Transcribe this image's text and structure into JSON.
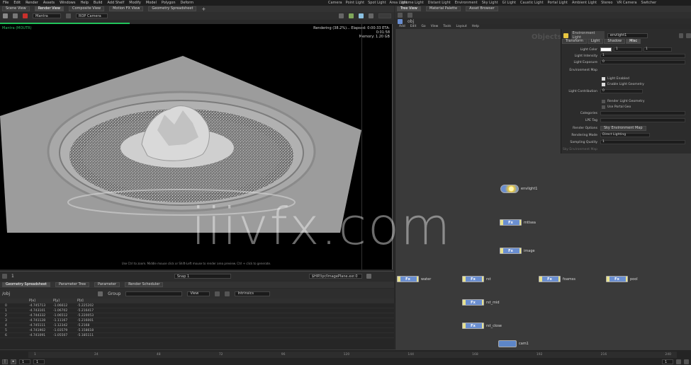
{
  "menu": {
    "left_items": [
      "File",
      "Edit",
      "Render",
      "Assets",
      "Windows",
      "Help",
      "Build",
      "Add Shelf",
      "Modify",
      "Model",
      "Polygon",
      "Deform"
    ],
    "center_items": [
      "Camera",
      "Point Light",
      "Spot Light",
      "Area Light"
    ],
    "right_items": [
      "Volume Light",
      "Distant Light",
      "Environment",
      "Sky Light",
      "GI Light",
      "Caustic Light",
      "Portal Light",
      "Ambient Light",
      "Stereo",
      "VR Camera",
      "Switcher"
    ]
  },
  "left_tabs": [
    "Scene View",
    "Render View",
    "Composite View",
    "Motion FX View",
    "Geometry Spreadsheet"
  ],
  "viewer": {
    "renderer_select": "Mantra",
    "camera_field": "ROP Camera",
    "left_label": "Mantra (MOUTR)",
    "render_line1": "Rendering (38.2%)...  Elapsed: 0:00:33  ETA: 0:01:58",
    "render_line2": "Memory:  1.20 GB",
    "caption": "Use Ctrl to zoom. Middle mouse click or Shift-Left mouse to render area preview. Ctrl + click to generate.",
    "snapshot_field": "Snap 1",
    "output_path": "$HIP/ipr/ImagePlane.exr.0",
    "snapshot_count": "1"
  },
  "lower_tabs": [
    "Geometry Spreadsheet",
    "Parameter Tree",
    "Parameter",
    "Render Scheduler"
  ],
  "sheet": {
    "node_path": "/obj",
    "attr_label": "Group",
    "view_label": "View",
    "intrinsics": "Intrinsics",
    "headers": [
      "",
      "P[x]",
      "P[y]",
      "P[z]",
      ""
    ],
    "rows": [
      [
        "0",
        "-4.745713",
        "-1.06612",
        "-5.225202"
      ],
      [
        "1",
        "-4.743101",
        "-1.06702",
        "-5.216417"
      ],
      [
        "2",
        "-4.744332",
        "-1.06512",
        "-5.220053"
      ],
      [
        "3",
        "-4.741128",
        "-1.11167",
        "-5.216001"
      ],
      [
        "4",
        "-4.745111",
        "-1.12342",
        "-5.2168"
      ],
      [
        "5",
        "-4.741902",
        "-1.03579",
        "-5.158618"
      ],
      [
        "6",
        "-4.741091",
        "-1.05507",
        "-5.185111"
      ]
    ]
  },
  "timeline": {
    "ticks": [
      "1",
      "24",
      "48",
      "72",
      "96",
      "120",
      "144",
      "168",
      "192",
      "216",
      "240"
    ],
    "frame_start": "1",
    "frame_end": "1",
    "current_frame": "1"
  },
  "network": {
    "tabs": [
      "Tree View",
      "Material Palette",
      "Asset Browser"
    ],
    "path": "obj",
    "menu_items": [
      "Add",
      "Edit",
      "Go",
      "View",
      "Tools",
      "Layout",
      "Help"
    ],
    "objects_label": "Objects",
    "nodes": [
      {
        "id": "envlight1",
        "label": "envlight1",
        "badge": "",
        "color": "#f0d060"
      },
      {
        "id": "mtlsea",
        "label": "mtlsea",
        "badge": "Fx",
        "color": "#6a8ed0"
      },
      {
        "id": "image",
        "label": "image",
        "badge": "Fx",
        "color": "#6a8ed0"
      },
      {
        "id": "water",
        "label": "water",
        "badge": "Fx",
        "color": "#6a8ed0"
      },
      {
        "id": "rst",
        "label": "rst",
        "badge": "Fx",
        "color": "#6a8ed0"
      },
      {
        "id": "foamss",
        "label": "foamss",
        "badge": "Fx",
        "color": "#6a8ed0"
      },
      {
        "id": "pool",
        "label": "pool",
        "badge": "Fx",
        "color": "#6a8ed0"
      },
      {
        "id": "rst_mid",
        "label": "rst_mid",
        "badge": "Fx",
        "color": "#6a8ed0"
      },
      {
        "id": "rst_close",
        "label": "rst_close",
        "badge": "Fx",
        "color": "#6a8ed0"
      },
      {
        "id": "cam1",
        "label": "cam1",
        "badge": "",
        "color": "#6a8ed0"
      }
    ]
  },
  "params": {
    "node_type": "Environment Light",
    "node_name": "envlight1",
    "tabs": [
      "Transform",
      "Light",
      "Shadow",
      "Misc"
    ],
    "rows": [
      {
        "label": "Light Color",
        "value": ""
      },
      {
        "label": "Light Intensity",
        "value": "1"
      },
      {
        "label": "Light Exposure",
        "value": "0"
      },
      {
        "label": "Environment Map",
        "value": ""
      },
      {
        "label": "Light Enabled",
        "value": ""
      },
      {
        "label": "Enable Light Geometry",
        "value": ""
      },
      {
        "label": "Light Contribution",
        "value": "0"
      },
      {
        "label": "Render Light Geometry",
        "value": ""
      },
      {
        "label": "Use Portal Geo",
        "value": ""
      },
      {
        "label": "Categories",
        "value": ""
      },
      {
        "label": "LPE Tag",
        "value": ""
      },
      {
        "label": "Render Options",
        "value": "Sky Environment Map"
      },
      {
        "label": "Rendering Mode",
        "value": "Direct Lighting"
      },
      {
        "label": "Sampling Quality",
        "value": "1"
      },
      {
        "label": "Sky Environment Map",
        "value": ""
      }
    ]
  },
  "watermark": "iiivfx.com"
}
